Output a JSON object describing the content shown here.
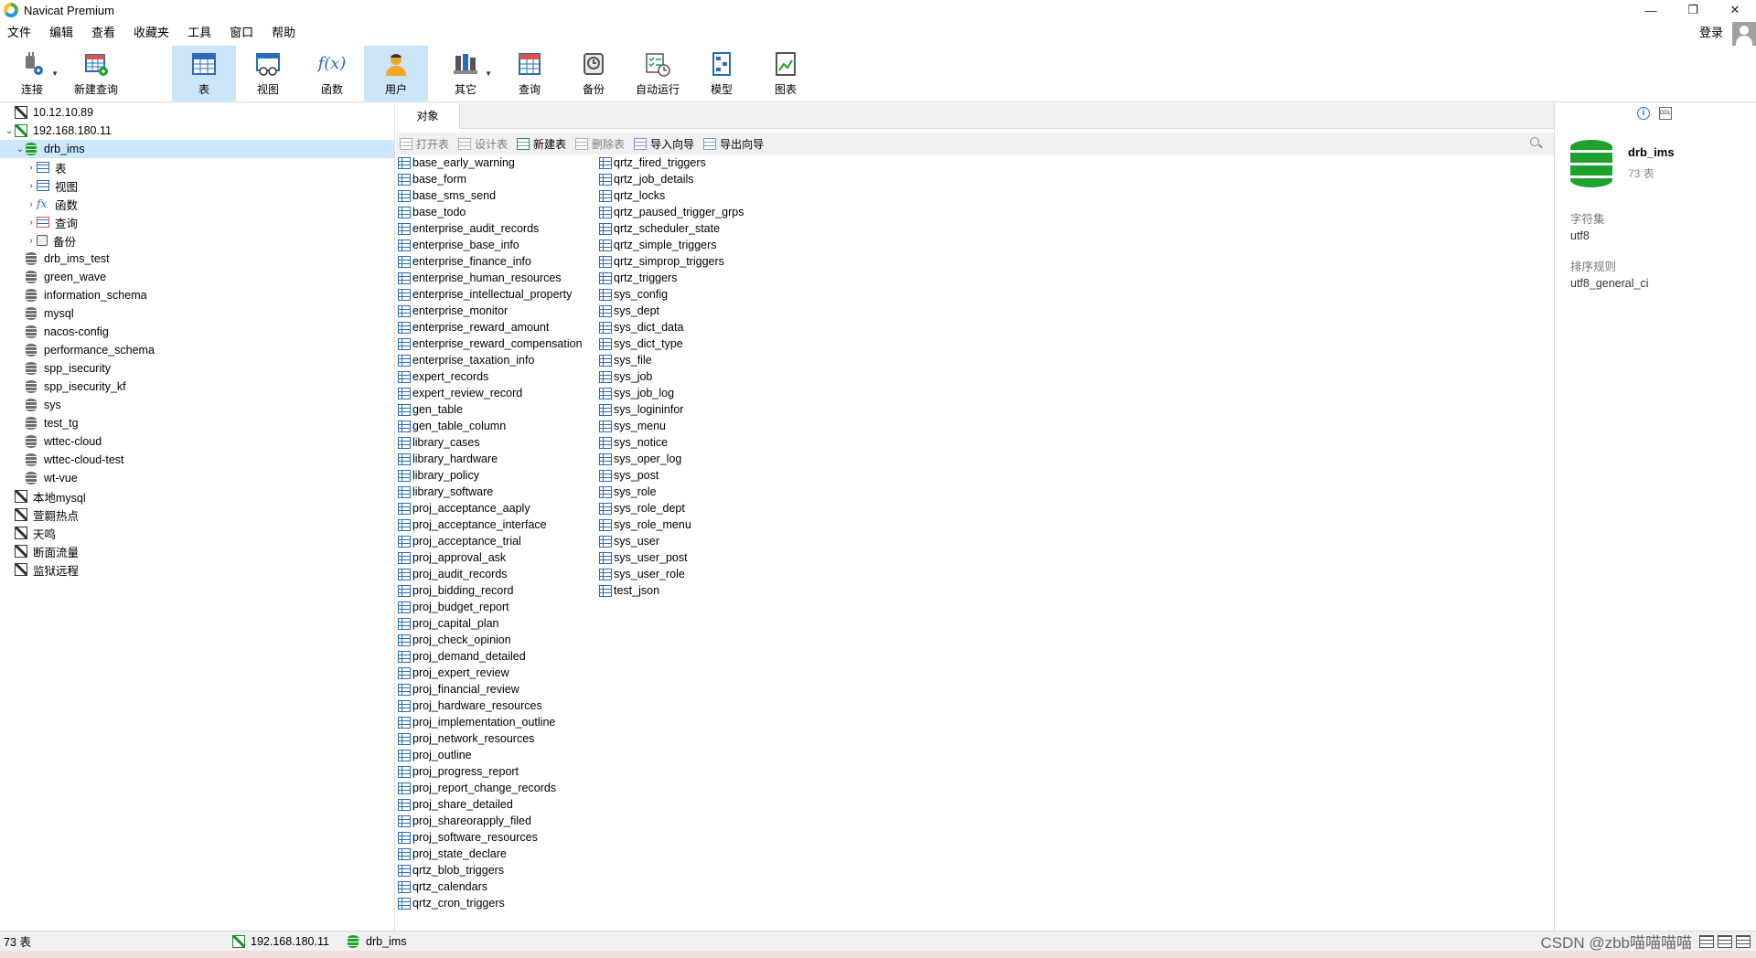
{
  "window": {
    "title": "Navicat Premium",
    "controls": [
      "—",
      "❐",
      "✕"
    ]
  },
  "menu": [
    "文件",
    "编辑",
    "查看",
    "收藏夹",
    "工具",
    "窗口",
    "帮助"
  ],
  "login": "登录",
  "toolbar": [
    {
      "label": "连接",
      "icon": "plug-icon"
    },
    {
      "label": "新建查询",
      "icon": "new-query-icon"
    },
    {
      "label": "表",
      "icon": "table-icon"
    },
    {
      "label": "视图",
      "icon": "view-icon"
    },
    {
      "label": "函数",
      "icon": "function-icon",
      "glyph": "f(x)"
    },
    {
      "label": "用户",
      "icon": "user-icon"
    },
    {
      "label": "其它",
      "icon": "tools-icon"
    },
    {
      "label": "查询",
      "icon": "query-icon"
    },
    {
      "label": "备份",
      "icon": "backup-icon"
    },
    {
      "label": "自动运行",
      "icon": "schedule-icon"
    },
    {
      "label": "模型",
      "icon": "model-icon"
    },
    {
      "label": "图表",
      "icon": "chart-icon"
    }
  ],
  "tree": {
    "connections_top": [
      "10.12.10.89",
      "192.168.180.11"
    ],
    "selected_db": "drb_ims",
    "db_children": [
      {
        "label": "表",
        "icon": "table-icon"
      },
      {
        "label": "视图",
        "icon": "view-icon"
      },
      {
        "label": "函数",
        "icon": "function-icon"
      },
      {
        "label": "查询",
        "icon": "query-icon"
      },
      {
        "label": "备份",
        "icon": "backup-icon"
      }
    ],
    "other_dbs": [
      "drb_ims_test",
      "green_wave",
      "information_schema",
      "mysql",
      "nacos-config",
      "performance_schema",
      "spp_isecurity",
      "spp_isecurity_kf",
      "sys",
      "test_tg",
      "wttec-cloud",
      "wttec-cloud-test",
      "wt-vue"
    ],
    "connections_bottom": [
      "本地mysql",
      "萱翾热点",
      "天鸣",
      "断面流量",
      "监狱远程"
    ]
  },
  "object_tab": "对象",
  "object_tools": [
    {
      "label": "打开表",
      "enabled": false
    },
    {
      "label": "设计表",
      "enabled": false
    },
    {
      "label": "新建表",
      "enabled": true
    },
    {
      "label": "删除表",
      "enabled": false
    },
    {
      "label": "导入向导",
      "enabled": true
    },
    {
      "label": "导出向导",
      "enabled": true
    }
  ],
  "tables_col1": [
    "base_early_warning",
    "base_form",
    "base_sms_send",
    "base_todo",
    "enterprise_audit_records",
    "enterprise_base_info",
    "enterprise_finance_info",
    "enterprise_human_resources",
    "enterprise_intellectual_property",
    "enterprise_monitor",
    "enterprise_reward_amount",
    "enterprise_reward_compensation",
    "enterprise_taxation_info",
    "expert_records",
    "expert_review_record",
    "gen_table",
    "gen_table_column",
    "library_cases",
    "library_hardware",
    "library_policy",
    "library_software",
    "proj_acceptance_aaply",
    "proj_acceptance_interface",
    "proj_acceptance_trial",
    "proj_approval_ask",
    "proj_audit_records",
    "proj_bidding_record",
    "proj_budget_report",
    "proj_capital_plan",
    "proj_check_opinion",
    "proj_demand_detailed",
    "proj_expert_review",
    "proj_financial_review",
    "proj_hardware_resources",
    "proj_implementation_outline",
    "proj_network_resources",
    "proj_outline",
    "proj_progress_report",
    "proj_report_change_records",
    "proj_share_detailed",
    "proj_shareorapply_filed",
    "proj_software_resources",
    "proj_state_declare",
    "qrtz_blob_triggers",
    "qrtz_calendars",
    "qrtz_cron_triggers"
  ],
  "tables_col2": [
    "qrtz_fired_triggers",
    "qrtz_job_details",
    "qrtz_locks",
    "qrtz_paused_trigger_grps",
    "qrtz_scheduler_state",
    "qrtz_simple_triggers",
    "qrtz_simprop_triggers",
    "qrtz_triggers",
    "sys_config",
    "sys_dept",
    "sys_dict_data",
    "sys_dict_type",
    "sys_file",
    "sys_job",
    "sys_job_log",
    "sys_logininfor",
    "sys_menu",
    "sys_notice",
    "sys_oper_log",
    "sys_post",
    "sys_role",
    "sys_role_dept",
    "sys_role_menu",
    "sys_user",
    "sys_user_post",
    "sys_user_role",
    "test_json"
  ],
  "info": {
    "name": "drb_ims",
    "count": "73 表",
    "charset_label": "字符集",
    "charset_value": "utf8",
    "collation_label": "排序规则",
    "collation_value": "utf8_general_ci"
  },
  "status": {
    "count": "73 表",
    "connection": "192.168.180.11",
    "database": "drb_ims",
    "watermark": "CSDN @zbb喵喵喵喵"
  },
  "colors": {
    "accent": "#2a6cb8",
    "db_green": "#1fa12d",
    "selection": "#cce8ff",
    "toolbar_active": "#cce4f7"
  }
}
